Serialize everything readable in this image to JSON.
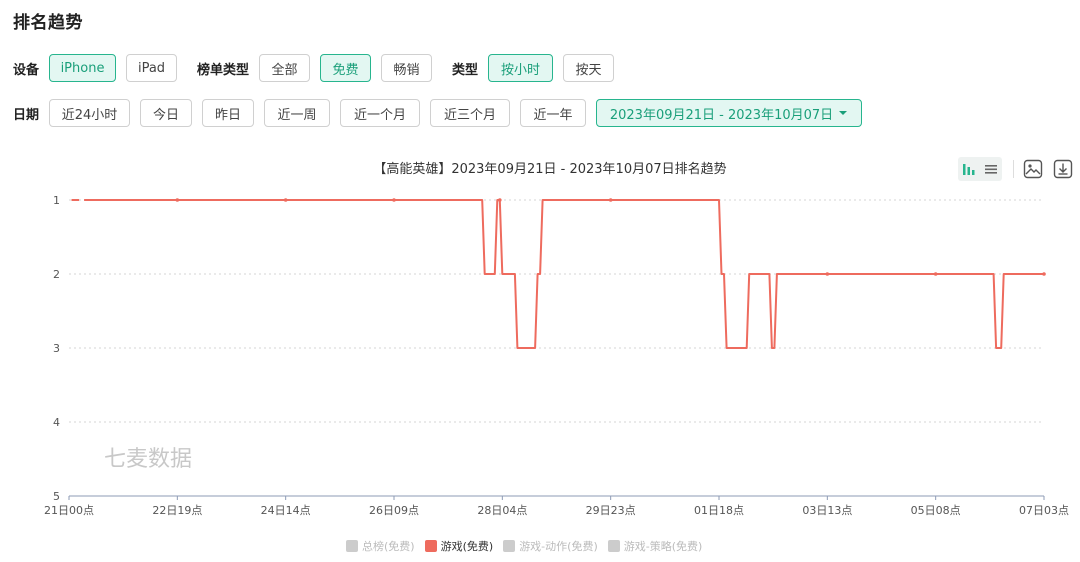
{
  "page_title": "排名趋势",
  "filters": {
    "device_label": "设备",
    "device_options": [
      "iPhone",
      "iPad"
    ],
    "device_selected": "iPhone",
    "list_type_label": "榜单类型",
    "list_type_options": [
      "全部",
      "免费",
      "畅销"
    ],
    "list_type_selected": "免费",
    "type_label": "类型",
    "type_options": [
      "按小时",
      "按天"
    ],
    "type_selected": "按小时",
    "date_label": "日期",
    "date_options": [
      "近24小时",
      "今日",
      "昨日",
      "近一周",
      "近一个月",
      "近三个月",
      "近一年"
    ],
    "date_range": "2023年09月21日 - 2023年10月07日"
  },
  "chart_title": "【高能英雄】2023年09月21日 - 2023年10月07日排名趋势",
  "watermark": "七麦数据",
  "icons": {
    "bar": "bar-chart-icon",
    "list": "list-icon",
    "image": "image-save-icon",
    "download": "download-icon"
  },
  "colors": {
    "accent": "#27b58e",
    "series": "#ee6b5e",
    "inactive_legend": "#cccccc"
  },
  "legend": [
    "总榜(免费)",
    "游戏(免费)",
    "游戏-动作(免费)",
    "游戏-策略(免费)"
  ],
  "legend_active": "游戏(免费)",
  "chart_data": {
    "type": "line",
    "title": "【高能英雄】2023年09月21日 - 2023年10月07日排名趋势",
    "xlabel": "",
    "ylabel": "",
    "y_inverted": true,
    "ylim": [
      1,
      5
    ],
    "y_ticks": [
      "1",
      "2",
      "3",
      "4",
      "5"
    ],
    "x_tick_labels": [
      "21日00点",
      "22日19点",
      "24日14点",
      "26日09点",
      "28日04点",
      "29日23点",
      "01日18点",
      "03日13点",
      "05日08点",
      "07日03点"
    ],
    "x_unit": "hours since 21日00点",
    "xlim": [
      0,
      387
    ],
    "grid": true,
    "series": [
      {
        "name": "游戏(免费)",
        "points": [
          [
            1,
            1
          ],
          [
            4,
            1
          ],
          [
            6,
            1
          ],
          [
            43,
            1
          ],
          [
            86,
            1
          ],
          [
            129,
            1
          ],
          [
            164,
            1
          ],
          [
            165,
            2
          ],
          [
            169,
            2
          ],
          [
            170,
            1
          ],
          [
            171,
            1
          ],
          [
            172,
            2
          ],
          [
            177,
            2
          ],
          [
            178,
            3
          ],
          [
            185,
            3
          ],
          [
            186,
            2
          ],
          [
            187,
            2
          ],
          [
            188,
            1
          ],
          [
            215,
            1
          ],
          [
            258,
            1
          ],
          [
            259,
            2
          ],
          [
            260,
            2
          ],
          [
            261,
            3
          ],
          [
            269,
            3
          ],
          [
            270,
            2
          ],
          [
            278,
            2
          ],
          [
            279,
            3
          ],
          [
            280,
            3
          ],
          [
            281,
            2
          ],
          [
            301,
            2
          ],
          [
            344,
            2
          ],
          [
            367,
            2
          ],
          [
            368,
            3
          ],
          [
            370,
            3
          ],
          [
            371,
            2
          ],
          [
            387,
            2
          ]
        ],
        "gaps_after_x": [
          4
        ],
        "markers_x": [
          43,
          86,
          129,
          171,
          215,
          301,
          344,
          387
        ]
      }
    ],
    "legend": [
      "总榜(免费)",
      "游戏(免费)",
      "游戏-动作(免费)",
      "游戏-策略(免费)"
    ],
    "legend_position": "bottom"
  }
}
